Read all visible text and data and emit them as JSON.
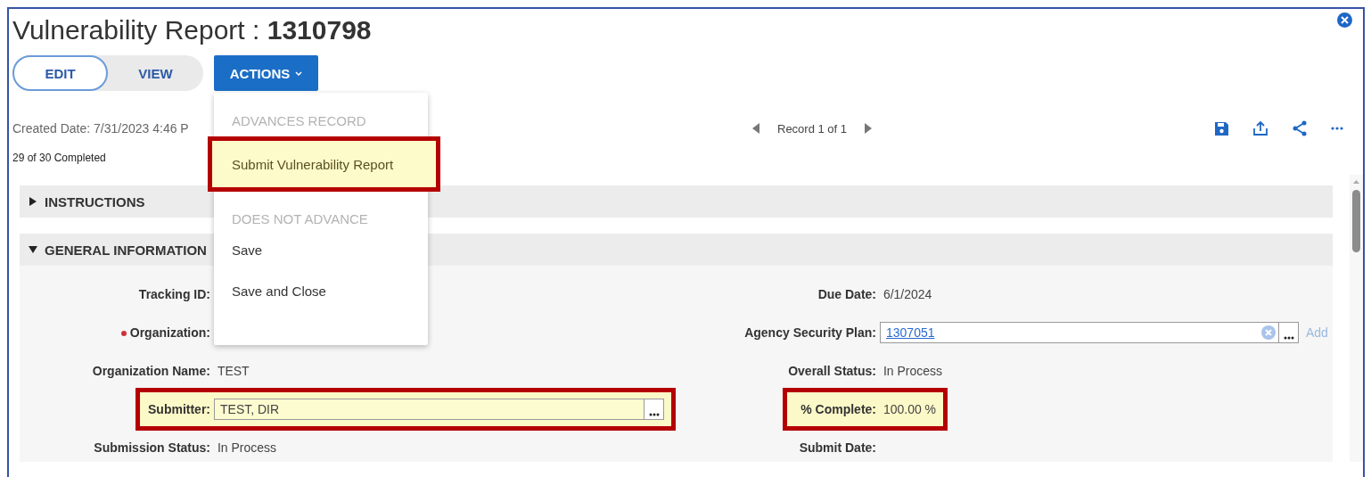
{
  "title": "Vulnerability Report : **1310798**",
  "mode_toggle": [
    {
      "label": "EDIT",
      "selected": true
    },
    {
      "label": "VIEW",
      "selected": false
    }
  ],
  "actions_button": {
    "label": "ACTIONS"
  },
  "actions_menu": [
    {
      "heading": "ADVANCES RECORD",
      "items": [
        {
          "label": "Submit Vulnerability Report",
          "highlighted": true
        }
      ]
    },
    {
      "heading": "DOES NOT ADVANCE",
      "items": [
        {
          "label": "Save",
          "highlighted": false
        },
        {
          "label": "Save and Close",
          "highlighted": false
        }
      ]
    }
  ],
  "created_date": "Created Date: 7/31/2023 4:46 P",
  "progress": "29 of 30 Completed",
  "record_nav": "Record 1 of 1",
  "sections": [
    {
      "title": "INSTRUCTIONS",
      "expanded": false
    },
    {
      "title": "GENERAL INFORMATION",
      "expanded": true
    }
  ],
  "left_fields": [
    {
      "kind": "text",
      "label": "Tracking ID:",
      "required": false,
      "highlighted": false
    },
    {
      "kind": "text",
      "label": "Organization:",
      "required": true,
      "highlighted": false
    },
    {
      "kind": "text",
      "label": "Organization Name:",
      "value": "TEST",
      "required": false,
      "highlighted": false
    },
    {
      "kind": "lookup",
      "label": "Submitter:",
      "value": "TEST, DIR",
      "required": false,
      "highlighted": true
    },
    {
      "kind": "text",
      "label": "Submission Status:",
      "value": "In Process",
      "required": false,
      "highlighted": false
    }
  ],
  "right_fields": [
    {
      "kind": "text",
      "label": "Due Date:",
      "value": "6/1/2024",
      "required": false,
      "highlighted": false
    },
    {
      "kind": "lookup",
      "label": "Agency Security Plan:",
      "value": "1307051",
      "link": true,
      "clearable": true,
      "add": "Add",
      "required": false,
      "highlighted": false
    },
    {
      "kind": "text",
      "label": "Overall Status:",
      "value": "In Process",
      "required": false,
      "highlighted": false
    },
    {
      "kind": "text",
      "label": "% Complete:",
      "value": "100.00 %",
      "required": false,
      "highlighted": true
    },
    {
      "kind": "text",
      "label": "Submit Date:",
      "required": false,
      "highlighted": false
    }
  ]
}
